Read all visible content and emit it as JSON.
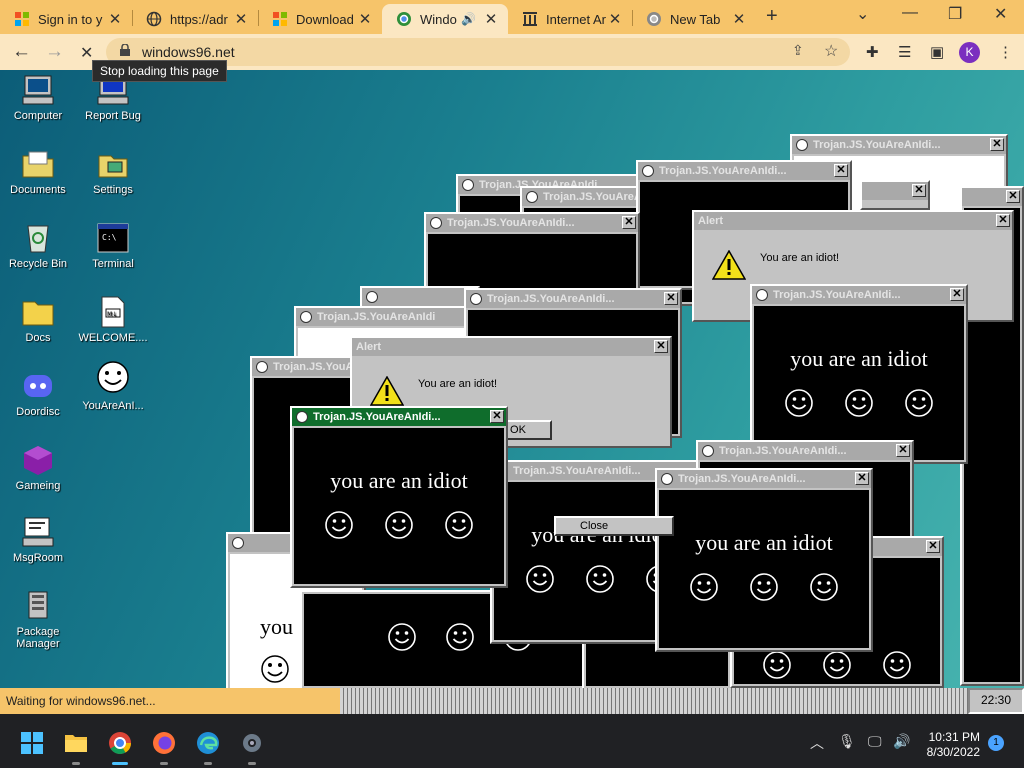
{
  "browser": {
    "tabs": [
      {
        "label": "Sign in to y",
        "icon": "microsoft-icon"
      },
      {
        "label": "https://adr",
        "icon": "globe-icon"
      },
      {
        "label": "Download",
        "icon": "microsoft-icon"
      },
      {
        "label": "Windo",
        "icon": "chrome-icon",
        "active": true
      },
      {
        "label": "Internet Ar",
        "icon": "archive-icon"
      },
      {
        "label": "New Tab",
        "icon": "chrome-icon"
      }
    ],
    "url": "windows96.net",
    "tooltip": "Stop loading this page",
    "profile_initial": "K",
    "status": "Waiting for windows96.net..."
  },
  "desktop": {
    "icons": [
      {
        "label": "Computer",
        "icon": "computer-icon"
      },
      {
        "label": "Report Bug",
        "icon": "report-bug-icon"
      },
      {
        "label": "Documents",
        "icon": "documents-folder-icon"
      },
      {
        "label": "Settings",
        "icon": "settings-icon"
      },
      {
        "label": "Recycle Bin",
        "icon": "recycle-bin-icon"
      },
      {
        "label": "Terminal",
        "icon": "terminal-icon"
      },
      {
        "label": "Docs",
        "icon": "docs-folder-icon"
      },
      {
        "label": "WELCOME....",
        "icon": "markdown-file-icon"
      },
      {
        "label": "Doordisc",
        "icon": "doordisc-icon"
      },
      {
        "label": "YouAreAnI...",
        "icon": "smiley-icon"
      },
      {
        "label": "Gameing",
        "icon": "gameing-icon"
      },
      {
        "label": "MsgRoom",
        "icon": "msgroom-icon"
      },
      {
        "label": "Package Manager",
        "icon": "package-manager-icon"
      }
    ],
    "window_title": "Trojan.JS.YouAreAnIdi...",
    "window_title_short": "Trojan.JS.YouAreAnIdi",
    "idiot_text": "you are an idiot",
    "alert_title": "Alert",
    "alert_message": "You are an idiot!",
    "ok_label": "OK",
    "close_label": "Close",
    "w96_clock": "22:30"
  },
  "taskbar": {
    "apps": [
      "start-icon",
      "file-explorer-icon",
      "chrome-icon",
      "firefox-icon",
      "edge-icon",
      "settings-gear-icon"
    ],
    "time": "10:31 PM",
    "date": "8/30/2022",
    "notifications": "1"
  }
}
